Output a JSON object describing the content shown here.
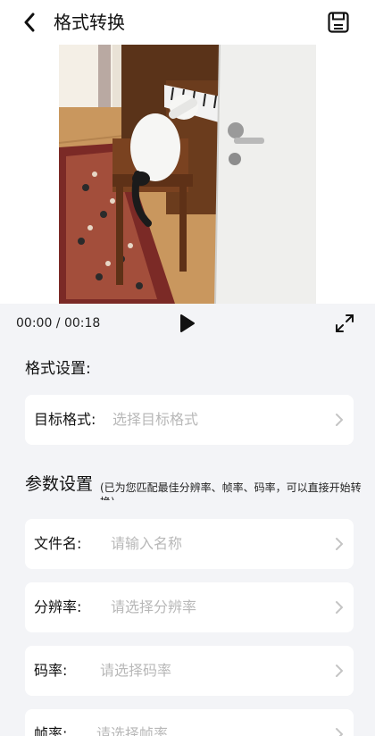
{
  "header": {
    "title": "格式转换"
  },
  "player": {
    "time": "00:00 / 00:18"
  },
  "format_section": {
    "title": "格式设置:",
    "target_format": {
      "label": "目标格式:",
      "placeholder": "选择目标格式"
    }
  },
  "param_section": {
    "title": "参数设置",
    "note": "(已为您匹配最佳分辨率、帧率、码率，可以直接开始转换)",
    "fields": [
      {
        "label": "文件名:",
        "placeholder": "请输入名称"
      },
      {
        "label": "分辨率:",
        "placeholder": "请选择分辨率"
      },
      {
        "label": "码率:",
        "placeholder": "请选择码率"
      },
      {
        "label": "帧率:",
        "placeholder": "请选择帧率"
      }
    ]
  },
  "colors": {
    "background": "#f3f4f7",
    "card": "#ffffff",
    "placeholder": "#b8b8b8"
  },
  "icons": [
    "back-arrow-icon",
    "save-disk-icon",
    "play-icon",
    "fullscreen-icon",
    "chevron-right-icon"
  ]
}
